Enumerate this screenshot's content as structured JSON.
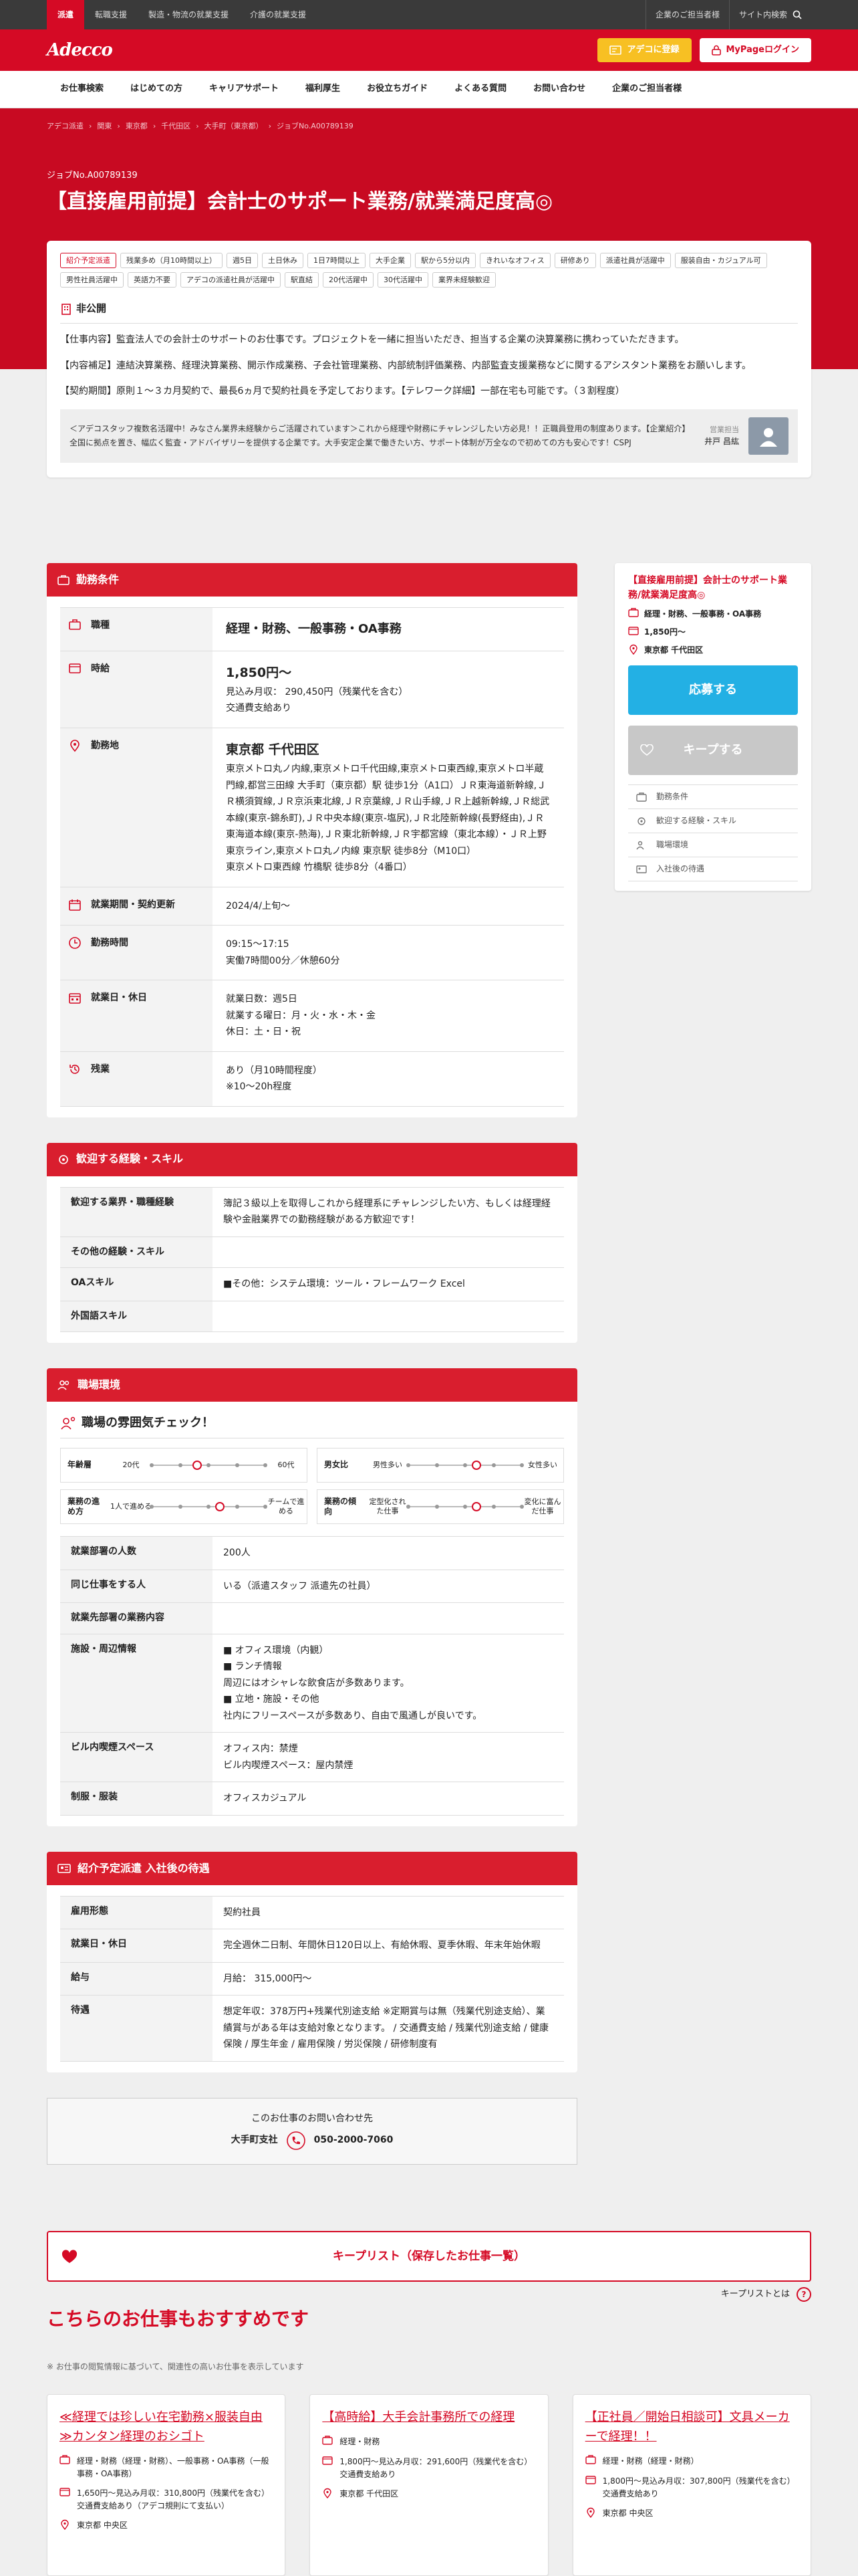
{
  "topbar": {
    "tabs": [
      "派遣",
      "転職支援",
      "製造・物流の就業支援",
      "介護の就業支援"
    ],
    "links": [
      "企業のご担当者様",
      "サイト内検索"
    ]
  },
  "header": {
    "logo": "Adecco",
    "register": "アデコに登録",
    "login": "MyPageログイン"
  },
  "nav": [
    "お仕事検索",
    "はじめての方",
    "キャリアサポート",
    "福利厚生",
    "お役立ちガイド",
    "よくある質問",
    "お問い合わせ",
    "企業のご担当者様"
  ],
  "breadcrumb": [
    "アデコ派遣",
    "関東",
    "東京都",
    "千代田区",
    "大手町（東京都）",
    "ジョブNo.A00789139"
  ],
  "job": {
    "no": "ジョブNo.A00789139",
    "title": "【直接雇用前提】会計士のサポート業務/就業満足度高◎"
  },
  "tags": [
    "紹介予定派遣",
    "残業多め（月10時間以上）",
    "週5日",
    "土日休み",
    "1日7時間以上",
    "大手企業",
    "駅から5分以内",
    "きれいなオフィス",
    "研修あり",
    "派遣社員が活躍中",
    "服装自由・カジュアル可",
    "男性社員活躍中",
    "英語力不要",
    "アデコの派遣社員が活躍中",
    "駅直結",
    "20代活躍中",
    "30代活躍中",
    "業界未経験歓迎"
  ],
  "summary": {
    "nonpublic": "非公開",
    "p1": "【仕事内容】監査法人での会計士のサポートのお仕事です。プロジェクトを一緒に担当いただき、担当する企業の決算業務に携わっていただきます。",
    "p2": "【内容補足】連結決算業務、経理決算業務、開示作成業務、子会社管理業務、内部統制評価業務、内部監査支援業務などに関するアシスタント業務をお願いします。",
    "p3": "【契約期間】原則１～３カ月契約で、最長6ヵ月で契約社員を予定しております。【テレワーク詳細】一部在宅も可能です。（３割程度）",
    "recruiter_msg": "＜アデコスタッフ複数名活躍中！みなさん業界未経験からご活躍されています＞これから経理や財務にチャレンジしたい方必見！！正職員登用の制度あります。【企業紹介】全国に拠点を置き、幅広く監査・アドバイザリーを提供する企業です。大手安定企業で働きたい方、サポート体制が万全なので初めての方も安心です！CSPJ",
    "recruiter_role": "営業担当",
    "recruiter_name": "井戸 昌紘"
  },
  "conditions": {
    "header": "勤務条件",
    "rows": [
      {
        "label": "職種",
        "value": "経理・財務、一般事務・OA事務"
      },
      {
        "label": "時給",
        "value": "1,850円〜",
        "sub1": "見込み月収： 290,450円（残業代を含む）",
        "sub2": "交通費支給あり"
      },
      {
        "label": "勤務地",
        "value": "東京都 千代田区",
        "sub1": "東京メトロ丸ノ内線,東京メトロ千代田線,東京メトロ東西線,東京メトロ半蔵門線,都営三田線 大手町（東京都）駅 徒歩1分（A1口）ＪＲ東海道新幹線,ＪＲ横須賀線,ＪＲ京浜東北線,ＪＲ京葉線,ＪＲ山手線,ＪＲ上越新幹線,ＪＲ総武本線(東京-錦糸町),ＪＲ中央本線(東京-塩尻),ＪＲ北陸新幹線(長野経由),ＪＲ東海道本線(東京-熱海),ＪＲ東北新幹線,ＪＲ宇都宮線（東北本線）・ＪＲ上野東京ライン,東京メトロ丸ノ内線 東京駅 徒歩8分（M10口）",
        "sub2": "東京メトロ東西線 竹橋駅 徒歩8分（4番口）"
      },
      {
        "label": "就業期間・契約更新",
        "value": "2024/4/上旬〜"
      },
      {
        "label": "勤務時間",
        "value": "09:15〜17:15",
        "sub1": "実働7時間00分／休憩60分"
      },
      {
        "label": "就業日・休日",
        "value": "就業日数：週5日",
        "sub1": "就業する曜日：月・火・水・木・金",
        "sub2": "休日：土・日・祝"
      },
      {
        "label": "残業",
        "value": "あり（月10時間程度）",
        "sub1": "※10〜20h程度"
      }
    ]
  },
  "skills": {
    "header": "歓迎する経験・スキル",
    "rows": [
      {
        "label": "歓迎する業界・職種経験",
        "value": "簿記３級以上を取得しこれから経理系にチャレンジしたい方、もしくは経理経験や金融業界での勤務経験がある方歓迎です！"
      },
      {
        "label": "その他の経験・スキル",
        "value": ""
      },
      {
        "label": "OAスキル",
        "value": "■その他：システム環境：ツール・フレームワーク Excel"
      },
      {
        "label": "外国語スキル",
        "value": ""
      }
    ]
  },
  "workplace": {
    "header": "職場環境",
    "atm_title": "職場の雰囲気チェック！",
    "gauges": [
      {
        "label": "年齢層",
        "min": "20代",
        "max": "60代",
        "level": 0.4
      },
      {
        "label": "男女比",
        "min": "男性多い",
        "max": "女性多い",
        "level": 0.6
      },
      {
        "label": "業務の進め方",
        "min": "1人で進める",
        "max": "チームで進める",
        "level": 0.6
      },
      {
        "label": "業務の傾向",
        "min": "定型化された仕事",
        "max": "変化に富んだ仕事",
        "level": 0.6
      }
    ],
    "rows": [
      {
        "label": "就業部署の人数",
        "value": "200人"
      },
      {
        "label": "同じ仕事をする人",
        "value": "いる（派遣スタッフ 派遣先の社員）"
      },
      {
        "label": "就業先部署の業務内容",
        "value": ""
      },
      {
        "label": "施設・周辺情報",
        "value": "■ オフィス環境（内観）",
        "sub1": "■ ランチ情報",
        "sub2": "周辺にはオシャレな飲食店が多数あります。",
        "sub3": "■ 立地・施設・その他",
        "sub4": "社内にフリースペースが多数あり、自由で風通しが良いです。"
      },
      {
        "label": "ビル内喫煙スペース",
        "value": "オフィス内：禁煙",
        "sub1": "ビル内喫煙スペース：屋内禁煙"
      },
      {
        "label": "制服・服装",
        "value": "オフィスカジュアル"
      }
    ]
  },
  "treatment": {
    "header": "紹介予定派遣 入社後の待遇",
    "rows": [
      {
        "label": "雇用形態",
        "value": "契約社員"
      },
      {
        "label": "就業日・休日",
        "value": "完全週休二日制、年間休日120日以上、有給休暇、夏季休暇、年末年始休暇"
      },
      {
        "label": "給与",
        "value": "月給： 315,000円〜"
      },
      {
        "label": "待遇",
        "value": "想定年収：378万円+残業代別途支給 ※定期賞与は無（残業代別途支給）、業績賞与がある年は支給対象となります。 / 交通費支給 / 残業代別途支給 / 健康保険 / 厚生年金 / 雇用保険 / 労災保険 / 研修制度有"
      }
    ]
  },
  "contact": {
    "label": "このお仕事のお問い合わせ先",
    "branch": "大手町支社",
    "phone": "050-2000-7060"
  },
  "keeplist": {
    "label": "キープリスト（保存したお仕事一覧）",
    "note": "キープリストとは",
    "q": "?"
  },
  "recommend": {
    "title": "こちらのお仕事もおすすめです",
    "note": "※ お仕事の閲覧情報に基づいて、関連性の高いお仕事を表示しています",
    "cards": [
      {
        "title": "≪経理では珍しい在宅勤務×服装自由≫カンタン経理のおシゴト",
        "type": "経理・財務（経理・財務）、一般事務・OA事務（一般事務・OA事務）",
        "pay": "1,650円〜見込み月収：310,800円（残業代を含む）交通費支給あり（アデコ規則にて支払い）",
        "place": "東京都 中央区"
      },
      {
        "title": "【高時給】大手会計事務所での経理",
        "type": "経理・財務",
        "pay": "1,800円〜見込み月収：291,600円（残業代を含む）交通費支給あり",
        "place": "東京都 千代田区"
      },
      {
        "title": "【正社員／開始日相談可】文具メーカーで経理！！",
        "type": "経理・財務（経理・財務）",
        "pay": "1,800円〜見込み月収：307,800円（残業代を含む）交通費支給あり",
        "place": "東京都 中央区"
      }
    ]
  },
  "sidebar": {
    "title": "【直接雇用前提】会計士のサポート業務/就業満足度高◎",
    "type": "経理・財務、一般事務・OA事務",
    "pay": "1,850円〜",
    "place": "東京都 千代田区",
    "apply": "応募する",
    "keep": "キープする",
    "anchors": [
      "勤務条件",
      "歓迎する経験・スキル",
      "職場環境",
      "入社後の待遇"
    ]
  },
  "colors": {
    "brand": "#d50a25",
    "apply": "#23b0e4",
    "register": "#f7c023"
  }
}
